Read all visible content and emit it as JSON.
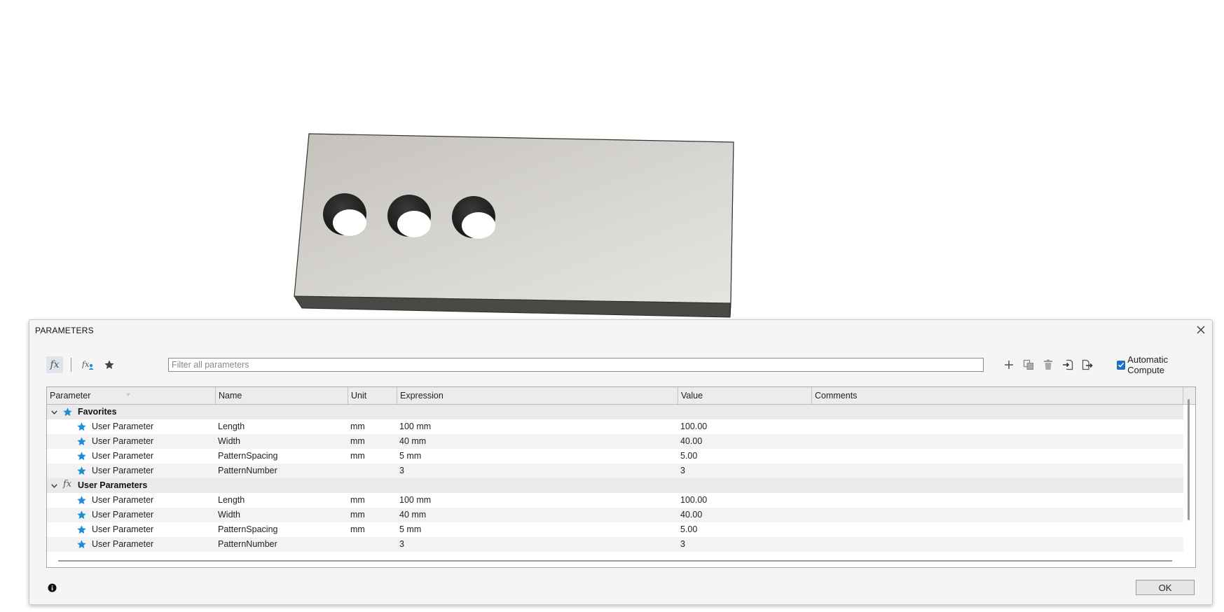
{
  "dialog": {
    "title": "PARAMETERS",
    "filter_placeholder": "Filter all parameters",
    "auto_compute_label": "Automatic Compute",
    "auto_compute_checked": true,
    "ok_label": "OK",
    "toolbar_icons": [
      "fx-icon",
      "user-fx-icon",
      "star-icon",
      "add-icon",
      "copy-icon",
      "delete-icon",
      "import-icon",
      "export-icon"
    ]
  },
  "columns": [
    "Parameter",
    "Name",
    "Unit",
    "Expression",
    "Value",
    "Comments"
  ],
  "groups": [
    {
      "label": "Favorites",
      "icon": "star-icon",
      "rows": [
        {
          "param": "User Parameter",
          "name": "Length",
          "unit": "mm",
          "expr": "100 mm",
          "value": "100.00",
          "comment": ""
        },
        {
          "param": "User Parameter",
          "name": "Width",
          "unit": "mm",
          "expr": "40 mm",
          "value": "40.00",
          "comment": ""
        },
        {
          "param": "User Parameter",
          "name": "PatternSpacing",
          "unit": "mm",
          "expr": "5 mm",
          "value": "5.00",
          "comment": ""
        },
        {
          "param": "User Parameter",
          "name": "PatternNumber",
          "unit": "",
          "expr": "3",
          "value": "3",
          "comment": ""
        }
      ]
    },
    {
      "label": "User Parameters",
      "icon": "fx-icon",
      "rows": [
        {
          "param": "User Parameter",
          "name": "Length",
          "unit": "mm",
          "expr": "100 mm",
          "value": "100.00",
          "comment": ""
        },
        {
          "param": "User Parameter",
          "name": "Width",
          "unit": "mm",
          "expr": "40 mm",
          "value": "40.00",
          "comment": ""
        },
        {
          "param": "User Parameter",
          "name": "PatternSpacing",
          "unit": "mm",
          "expr": "5 mm",
          "value": "5.00",
          "comment": ""
        },
        {
          "param": "User Parameter",
          "name": "PatternNumber",
          "unit": "",
          "expr": "3",
          "value": "3",
          "comment": ""
        }
      ]
    }
  ],
  "colors": {
    "accent": "#1a8fd6",
    "checkbox": "#1f6fbf"
  }
}
